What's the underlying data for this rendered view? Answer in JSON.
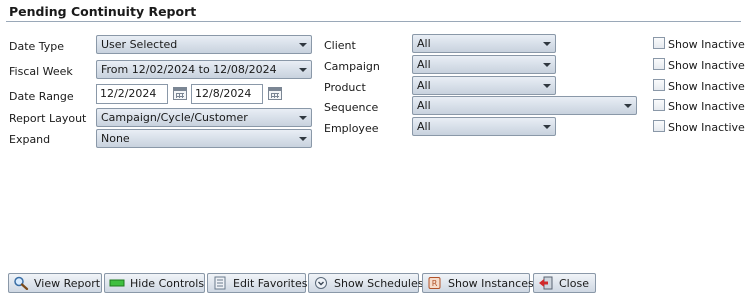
{
  "title": "Pending Continuity Report",
  "left": {
    "date_type": {
      "label": "Date Type",
      "value": "User Selected"
    },
    "fiscal_week": {
      "label": "Fiscal Week",
      "value": "From 12/02/2024 to 12/08/2024"
    },
    "date_range": {
      "label": "Date Range",
      "from": "12/2/2024",
      "to": "12/8/2024"
    },
    "report_layout": {
      "label": "Report Layout",
      "value": "Campaign/Cycle/Customer"
    },
    "expand": {
      "label": "Expand",
      "value": "None"
    }
  },
  "right": {
    "client": {
      "label": "Client",
      "value": "All"
    },
    "campaign": {
      "label": "Campaign",
      "value": "All"
    },
    "product": {
      "label": "Product",
      "value": "All"
    },
    "sequence": {
      "label": "Sequence",
      "value": "All"
    },
    "employee": {
      "label": "Employee",
      "value": "All"
    }
  },
  "show_inactive_label": "Show Inactive",
  "buttons": {
    "view_report": "View Report",
    "hide_controls": "Hide Controls",
    "edit_favorites": "Edit Favorites",
    "show_schedules": "Show Schedules",
    "show_instances": "Show Instances",
    "close": "Close"
  }
}
